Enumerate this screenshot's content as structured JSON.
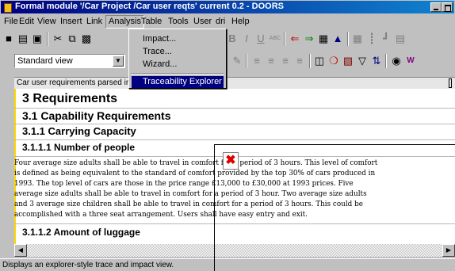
{
  "window": {
    "title": "Formal module '/Car Project /Car user reqts' current 0.2 - DOORS"
  },
  "menubar": [
    {
      "label": "File"
    },
    {
      "label": "Edit"
    },
    {
      "label": "View"
    },
    {
      "label": "Insert"
    },
    {
      "label": "Link"
    },
    {
      "label": "Analysis"
    },
    {
      "label": "Table"
    },
    {
      "label": "Tools"
    },
    {
      "label": "User"
    },
    {
      "label": "dri"
    },
    {
      "label": "Help"
    }
  ],
  "analysis_menu": {
    "items": [
      "Impact...",
      "Trace...",
      "Wizard..."
    ],
    "selected": "Traceability Explorer"
  },
  "toolbar": {
    "view_select_value": "Standard view"
  },
  "header_bar": {
    "text": "Car user requirements parsed in"
  },
  "document": {
    "h1": "3 Requirements",
    "h2": "3.1 Capability Requirements",
    "h3": "3.1.1 Carrying Capacity",
    "h4": "3.1.1.1 Number of people",
    "paragraph_lines": [
      "Four average size adults shall be able to travel in comfort for a period of 3 hours. This level of comfort",
      "is defined as being equivalent to the standard of comfort provided by the top 30% of cars produced in",
      "1993.  The top level of cars are those in the price range £13,000  to £30,000 at 1993 prices. Five",
      "average size adults shall be able to travel in comfort for a period of 3 hour. Two average size adults",
      "and 3 average size children shall be able to travel in comfort for a period of 3 hours. This could be",
      "accomplished with a three seat arrangement.  Users shall have easy entry and exit."
    ],
    "h5": "3.1.1.2 Amount of luggage"
  },
  "statusbar": {
    "text": "Displays an explorer-style trace and impact view."
  },
  "icons": {
    "overlay_icon": "close-x-icon"
  },
  "colors": {
    "titlebar": "#000080",
    "selection": "#000080",
    "change_bar": "#ffd800",
    "overlay_x": "#e00000"
  }
}
